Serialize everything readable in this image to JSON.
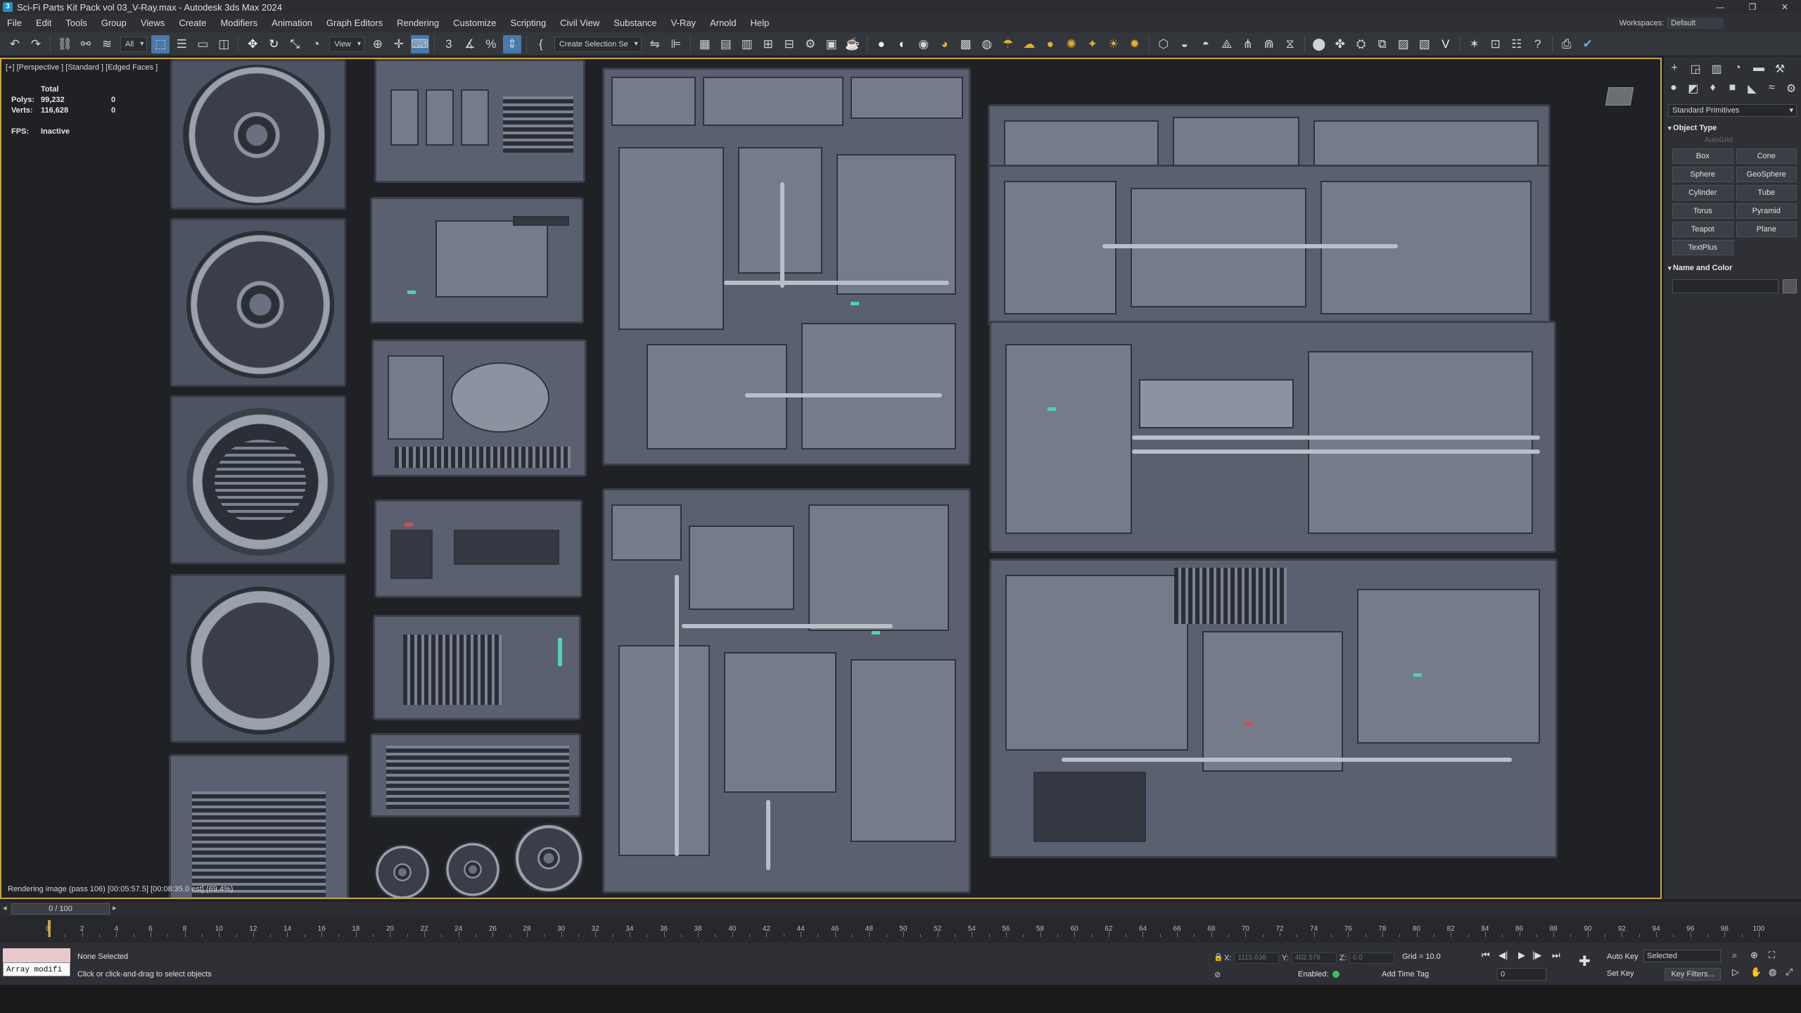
{
  "window": {
    "title": "Sci-Fi Parts Kit Pack vol 03_V-Ray.max - Autodesk 3ds Max 2024",
    "controls": [
      "—",
      "❐",
      "✕"
    ]
  },
  "menu": {
    "items": [
      "File",
      "Edit",
      "Tools",
      "Group",
      "Views",
      "Create",
      "Modifiers",
      "Animation",
      "Graph Editors",
      "Rendering",
      "Customize",
      "Scripting",
      "Civil View",
      "Substance",
      "V-Ray",
      "Arnold",
      "Help"
    ],
    "workspaces_label": "Workspaces:",
    "workspaces_value": "Default"
  },
  "toolbar": {
    "selection_filter": "All",
    "ref_coord": "View",
    "named_selection": "Create Selection Se"
  },
  "viewport": {
    "label": "[+] [Perspective ] [Standard ] [Edged Faces ]",
    "stats": {
      "total_label": "Total",
      "polys_label": "Polys:",
      "polys_total": "99,232",
      "polys_sel": "0",
      "verts_label": "Verts:",
      "verts_total": "116,628",
      "verts_sel": "0",
      "fps_label": "FPS:",
      "fps_value": "Inactive"
    },
    "render_status": "Rendering image (pass 106) [00:05:57.5] [00:08:35.0 est] (69.4%)"
  },
  "command_panel": {
    "category": "Standard Primitives",
    "object_type_title": "Object Type",
    "autogrid": "AutoGrid",
    "primitives": [
      "Box",
      "Cone",
      "Sphere",
      "GeoSphere",
      "Cylinder",
      "Tube",
      "Torus",
      "Pyramid",
      "Teapot",
      "Plane",
      "TextPlus"
    ],
    "name_color_title": "Name and Color"
  },
  "timeline": {
    "position": "0 / 100",
    "ticks": [
      "0",
      "2",
      "4",
      "6",
      "8",
      "10",
      "12",
      "14",
      "16",
      "18",
      "20",
      "22",
      "24",
      "26",
      "28",
      "30",
      "32",
      "34",
      "36",
      "38",
      "40",
      "42",
      "44",
      "46",
      "48",
      "50",
      "52",
      "54",
      "56",
      "58",
      "60",
      "62",
      "64",
      "66",
      "68",
      "70",
      "72",
      "74",
      "76",
      "78",
      "80",
      "82",
      "84",
      "86",
      "88",
      "90",
      "92",
      "94",
      "96",
      "98",
      "100"
    ]
  },
  "status": {
    "maxscript": "Array modifi",
    "selection": "None Selected",
    "prompt": "Click or click-and-drag to select objects",
    "x_label": "X:",
    "x_value": "1115.638",
    "y_label": "Y:",
    "y_value": "402.579",
    "z_label": "Z:",
    "z_value": "0.0",
    "grid": "Grid = 10.0",
    "enabled": "Enabled:",
    "add_time_tag": "Add Time Tag",
    "auto_key": "Auto Key",
    "selected": "Selected",
    "set_key": "Set Key",
    "key_filters": "Key Filters...",
    "frame": "0"
  },
  "colors": {
    "viewport_border": "#c8a63d",
    "active_tool": "#4a78a8",
    "bg": "#1f2125"
  }
}
